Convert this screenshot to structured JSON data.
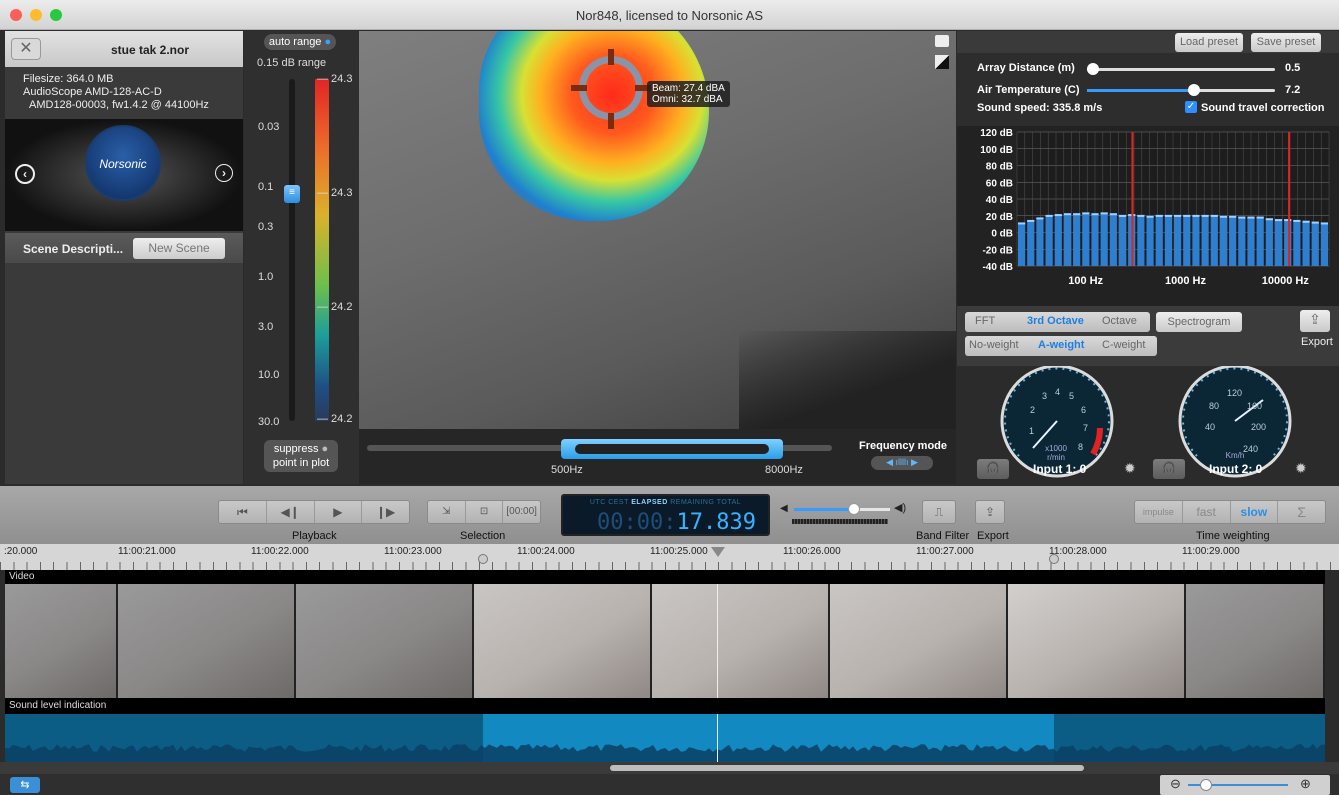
{
  "window": {
    "title": "Nor848, licensed to Norsonic AS"
  },
  "left_panel": {
    "filename": "stue tak 2.nor",
    "info": [
      "Filesize: 364.0 MB",
      "AudioScope AMD-128-AC-D",
      "AMD128-00003, fw1.4.2 @ 44100Hz"
    ],
    "logo_text": "Norsonic",
    "scene_label": "Scene Descripti...",
    "new_scene_button": "New Scene"
  },
  "scale": {
    "auto_range": "auto range",
    "range_label": "0.15 dB range",
    "ticks": [
      "0.03",
      "0.1",
      "0.3",
      "1.0",
      "3.0",
      "10.0",
      "30.0"
    ],
    "color_labels": [
      "24.3",
      "24.3",
      "24.2",
      "24.2"
    ],
    "suppress": "suppress",
    "point_in_plot": "point in plot"
  },
  "overlay": {
    "beam": "Beam: 27.4 dBA",
    "omni": "Omni: 32.7 dBA"
  },
  "frequency": {
    "low": "500Hz",
    "high": "8000Hz",
    "mode_label": "Frequency mode"
  },
  "right_panel": {
    "load_preset": "Load preset",
    "save_preset": "Save preset",
    "array_distance_label": "Array Distance (m)",
    "array_distance_value": "0.5",
    "array_distance_fraction": 0.03,
    "air_temp_label": "Air Temperature (C)",
    "air_temp_value": "7.2",
    "air_temp_fraction": 0.57,
    "sound_speed": "Sound speed:  335.8 m/s",
    "travel_correction": "Sound travel correction",
    "y_ticks": [
      "120 dB",
      "100 dB",
      "80 dB",
      "60 dB",
      "40 dB",
      "20 dB",
      "0 dB",
      "-20 dB",
      "-40 dB"
    ],
    "x_ticks": [
      "100 Hz",
      "1000 Hz",
      "10000 Hz"
    ],
    "tabs": [
      "FFT",
      "3rd Octave",
      "Octave",
      "Spectrogram"
    ],
    "weights": [
      "No-weight",
      "A-weight",
      "C-weight"
    ],
    "export": "Export",
    "gauge1_unit": "x1000\nr/min",
    "gauge2_unit": "Km/h",
    "input1": "Input 1: 0",
    "input2": "Input 2: 0"
  },
  "toolbar": {
    "playback_label": "Playback",
    "selection_label": "Selection",
    "lcd_modes": [
      "UTC",
      "CEST",
      "ELAPSED",
      "REMAINING",
      "TOTAL"
    ],
    "lcd_dim": "00:00:",
    "lcd_value": "17.839",
    "band_filter": "Band Filter",
    "export": "Export",
    "time_weighting_label": "Time weighting",
    "tw_options": [
      "impulse",
      "fast",
      "slow",
      "Σ"
    ],
    "volume_level": 0.63
  },
  "timeline": {
    "ticks": [
      ":20.000",
      "11:00:21.000",
      "11:00:22.000",
      "11:00:23.000",
      "11:00:24.000",
      "11:00:25.000",
      "11:00:26.000",
      "11:00:27.000",
      "11:00:28.000",
      "11:00:29.000"
    ],
    "video_label": "Video",
    "sound_label": "Sound level indication"
  }
}
